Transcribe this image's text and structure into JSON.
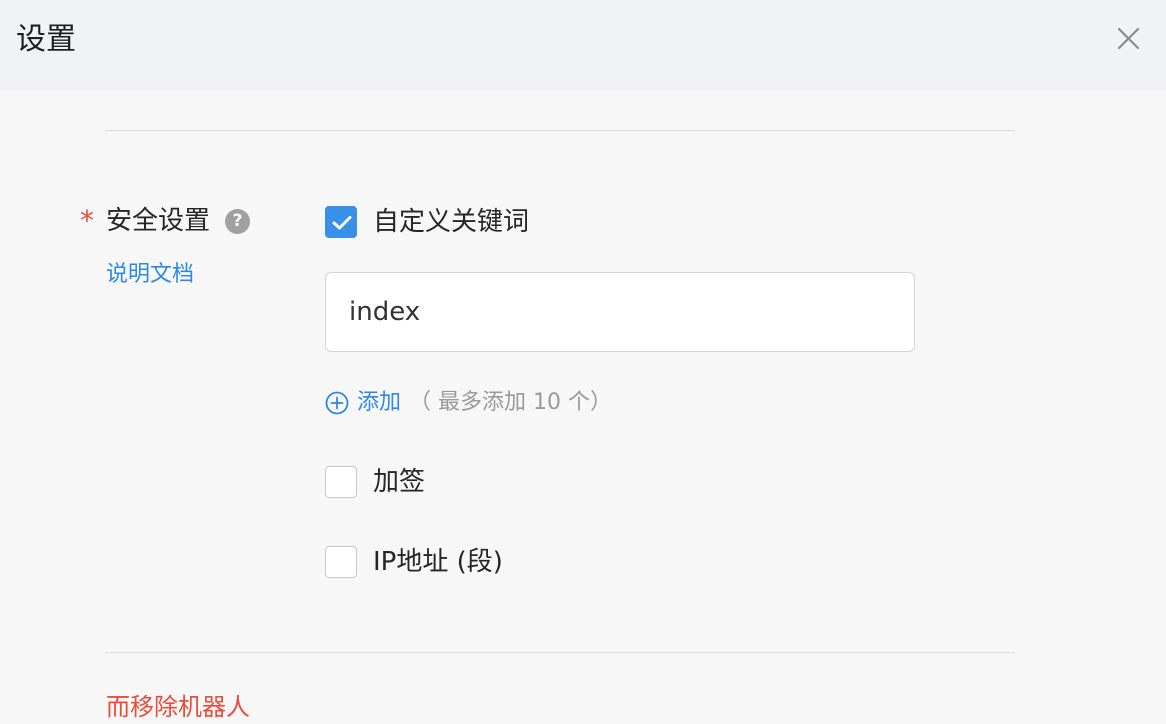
{
  "dialog": {
    "title": "设置",
    "close_icon": "close-icon"
  },
  "security": {
    "required_mark": "*",
    "label": "安全设置",
    "help_icon": "question-circle-icon",
    "help_glyph": "?",
    "doc_link": "说明文档",
    "options": [
      {
        "label": "自定义关键词",
        "checked": true
      },
      {
        "label": "加签",
        "checked": false
      },
      {
        "label": "IP地址 (段)",
        "checked": false
      }
    ],
    "keyword_input": {
      "value": "index",
      "placeholder": ""
    },
    "add": {
      "icon": "plus-circle-icon",
      "label": "添加",
      "hint": "（ 最多添加 10 个）"
    }
  },
  "footer": {
    "remove_robot": "而移除机器人"
  },
  "colors": {
    "accent": "#2f88e6",
    "checkbox_checked": "#3a8fe8",
    "danger": "#e84d3d",
    "header_bg": "#f1f2f5",
    "body_bg": "#f7f7f7"
  }
}
